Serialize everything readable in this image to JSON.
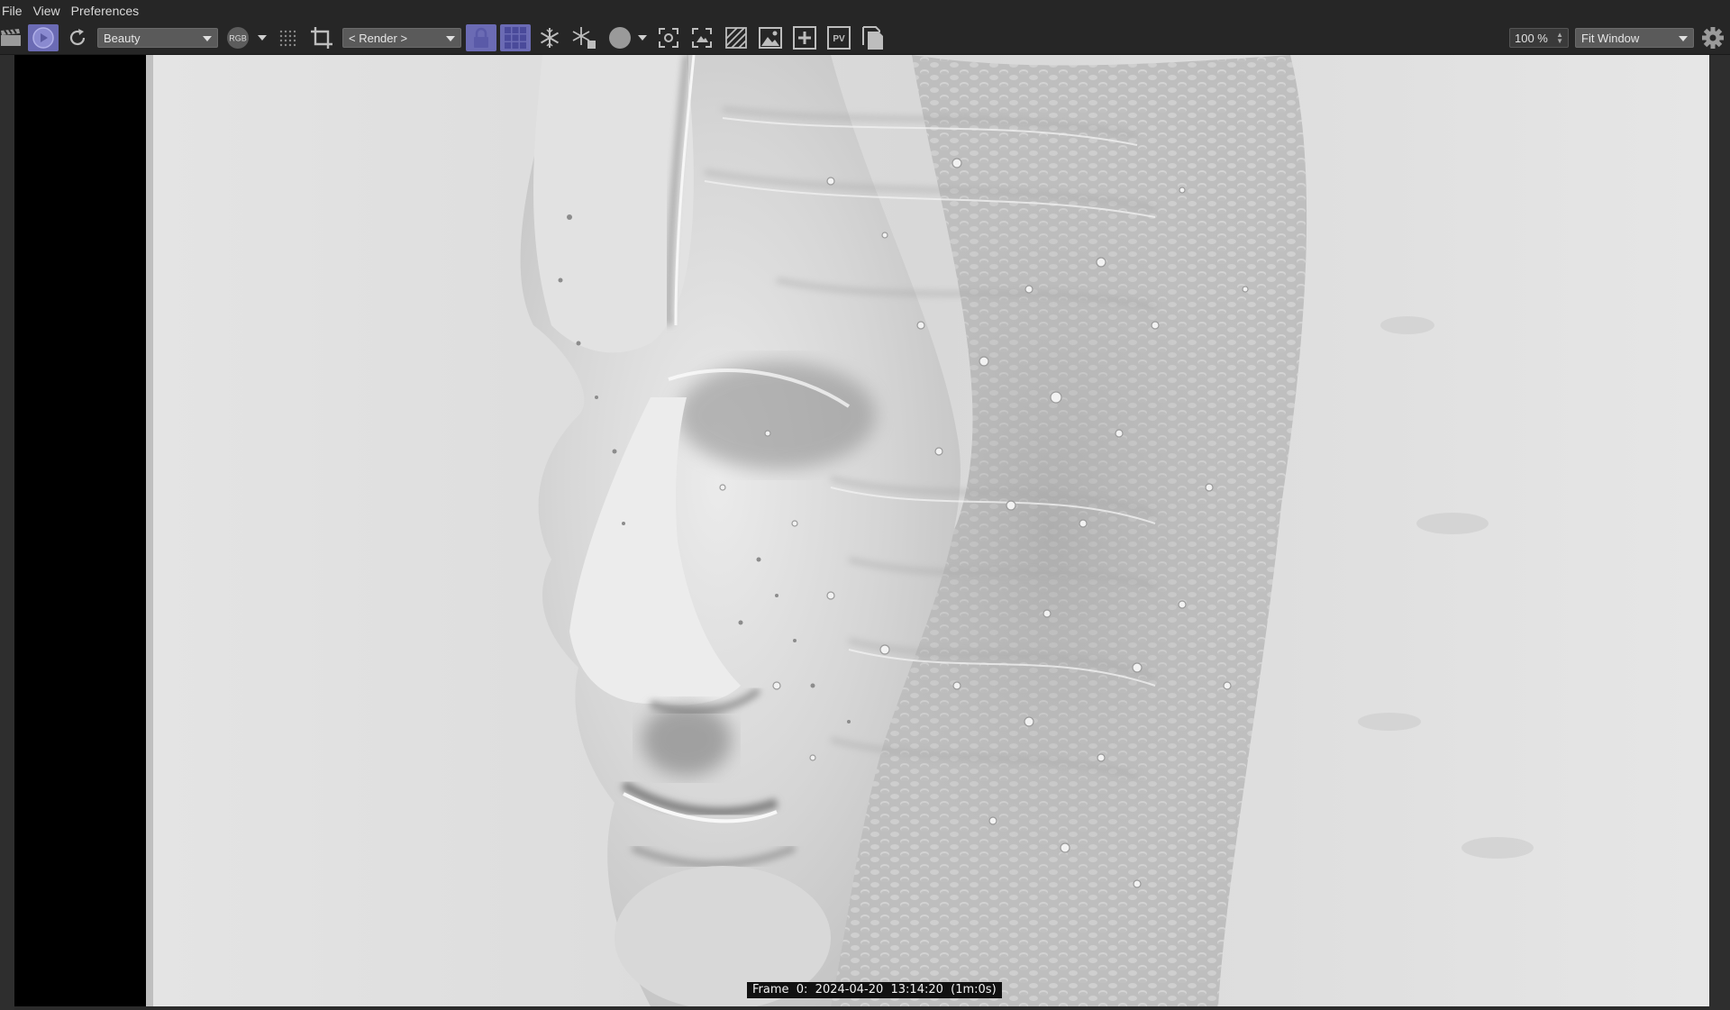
{
  "menu": {
    "file": "File",
    "view": "View",
    "preferences": "Preferences"
  },
  "toolbar": {
    "render_pass": "Beauty",
    "channel_badge": "RGB",
    "camera_select": "< Render >",
    "pv_label": "PV",
    "zoom_value": "100 %",
    "fit_mode": "Fit Window"
  },
  "viewer": {
    "frame_info": "Frame  0:  2024-04-20  13:14:20  (1m:0s)"
  },
  "colors": {
    "accent_active": "#6b6bb4",
    "toolbar_bg": "#262626",
    "viewer_bg": "#2b2b2b"
  }
}
